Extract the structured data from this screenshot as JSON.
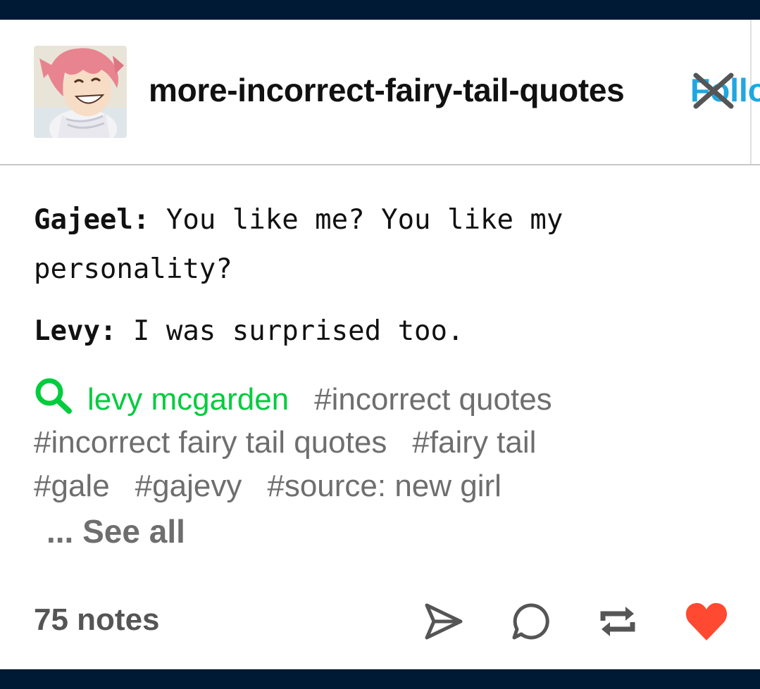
{
  "header": {
    "blog_name": "more-incorrect-fairy-tail-quotes",
    "follow_label": "Follo"
  },
  "post": {
    "lines": [
      {
        "speaker": "Gajeel:",
        "text": " You like me? You like my"
      },
      {
        "speaker": "",
        "text": "personality?"
      },
      {
        "speaker": "Levy:",
        "text": " I was surprised too."
      }
    ]
  },
  "tags": {
    "search_tag": "levy mcgarden",
    "items": [
      "#incorrect quotes",
      "#incorrect fairy tail quotes",
      "#fairy tail",
      "#gale",
      "#gajevy",
      "#source: new girl"
    ],
    "see_all": "... See all"
  },
  "footer": {
    "notes": "75 notes"
  },
  "colors": {
    "nav_bar": "#001935",
    "search_tag": "#00cc3d",
    "like_heart": "#ff4930",
    "follow": "#1fa7e0"
  },
  "icons": [
    "close-icon",
    "search-icon",
    "share-icon",
    "reply-icon",
    "reblog-icon",
    "heart-icon"
  ]
}
